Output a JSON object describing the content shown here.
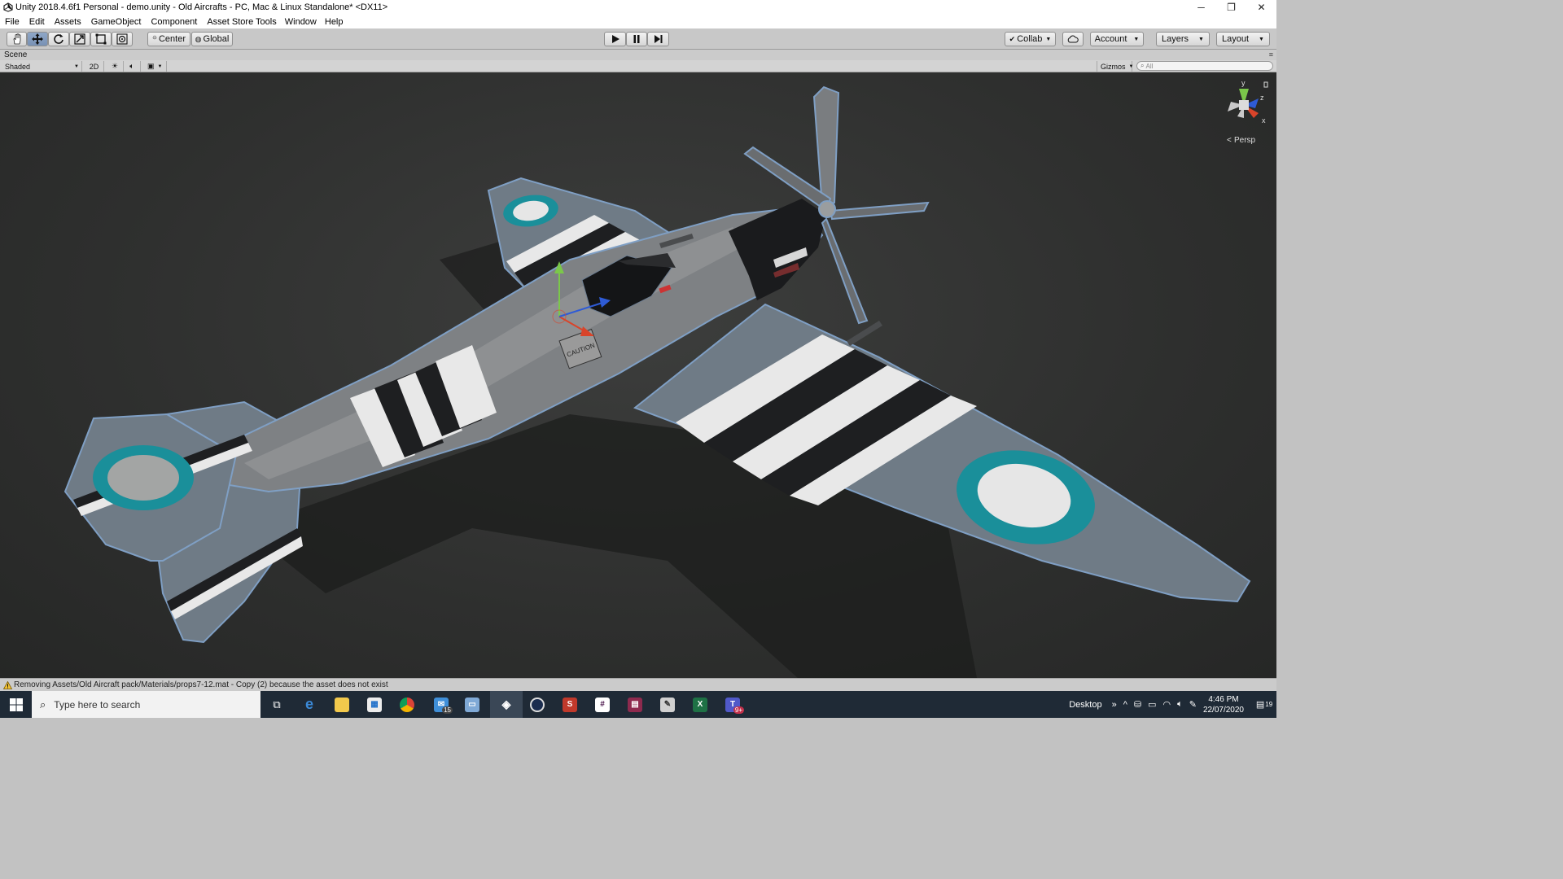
{
  "window": {
    "title": "Unity 2018.4.6f1 Personal - demo.unity - Old Aircrafts - PC, Mac & Linux Standalone* <DX11>"
  },
  "menu": [
    "File",
    "Edit",
    "Assets",
    "GameObject",
    "Component",
    "Asset Store Tools",
    "Window",
    "Help"
  ],
  "toolbar": {
    "pivot_label": "Center",
    "space_label": "Global",
    "collab_label": "Collab",
    "account_label": "Account",
    "layers_label": "Layers",
    "layout_label": "Layout"
  },
  "scene": {
    "tab_label": "Scene",
    "shading_mode": "Shaded",
    "mode_2d": "2D",
    "gizmos_label": "Gizmos",
    "search_placeholder": "All",
    "persp_label": "Persp",
    "axis_y": "y",
    "axis_z": "z",
    "axis_x": "x",
    "caution_text": "CAUTION"
  },
  "status": {
    "message": "Removing Assets/Old Aircraft pack/Materials/props7-12.mat - Copy (2) because the asset does not exist"
  },
  "taskbar": {
    "search_placeholder": "Type here to search",
    "mail_badge": "15",
    "teams_badge": "9+",
    "desktop_label": "Desktop",
    "time": "4:46 PM",
    "date": "22/07/2020",
    "notification_count": "19"
  },
  "colors": {
    "accent_selected": "#7891b4",
    "viewport_bg": "#2e2f2e",
    "roundel_teal": "#1a8f9a",
    "taskbar_bg": "#1f2a36"
  }
}
